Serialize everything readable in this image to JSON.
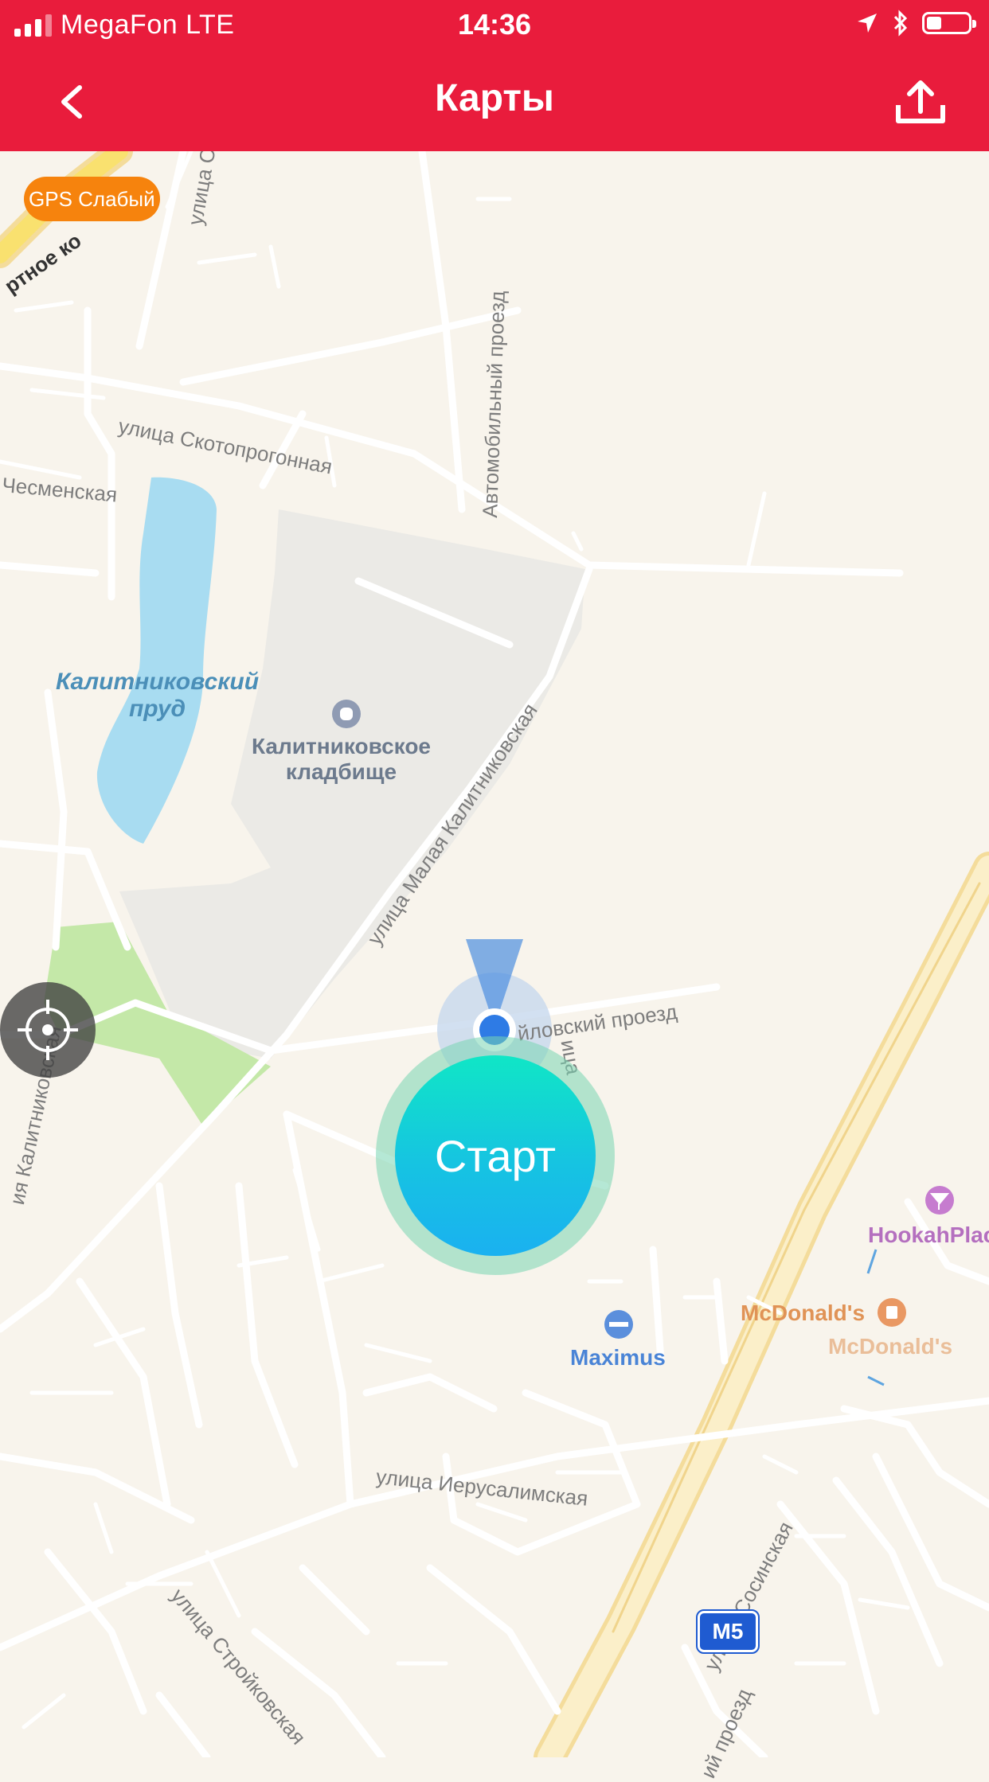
{
  "status_bar": {
    "carrier": "MegaFon   LTE",
    "time": "14:36",
    "battery_level": 0.35
  },
  "nav": {
    "title": "Карты",
    "back_icon": "chevron-left-icon",
    "share_icon": "share-upload-icon"
  },
  "gps": {
    "label": "GPS Слабый"
  },
  "start": {
    "label": "Старт"
  },
  "map": {
    "streets": {
      "sredn": "улица Сре",
      "sport": "ртное ко",
      "avtomob": "Автомобильный проезд",
      "skoto": "улица Скотопрогонная",
      "chesm": "Чесменская",
      "malaya": "улица Малая Калитниковская",
      "proezd": "йловский проезд",
      "vertical": "ица",
      "kalitn": "ия Калитниковская",
      "ierus": "улица Иерусалимская",
      "stroik": "улица Стройковская",
      "sosin": "улица Сосинская",
      "proezd2": "ий проезд"
    },
    "pond": "Калитниковский\nпруд",
    "cemetery": "Калитниковское\nкладбище",
    "poi": {
      "maximus": "Maximus",
      "mcd1": "McDonald's",
      "mcd2": "McDonald's",
      "hookah": "HookahPlac"
    },
    "road_badge": "M5"
  }
}
